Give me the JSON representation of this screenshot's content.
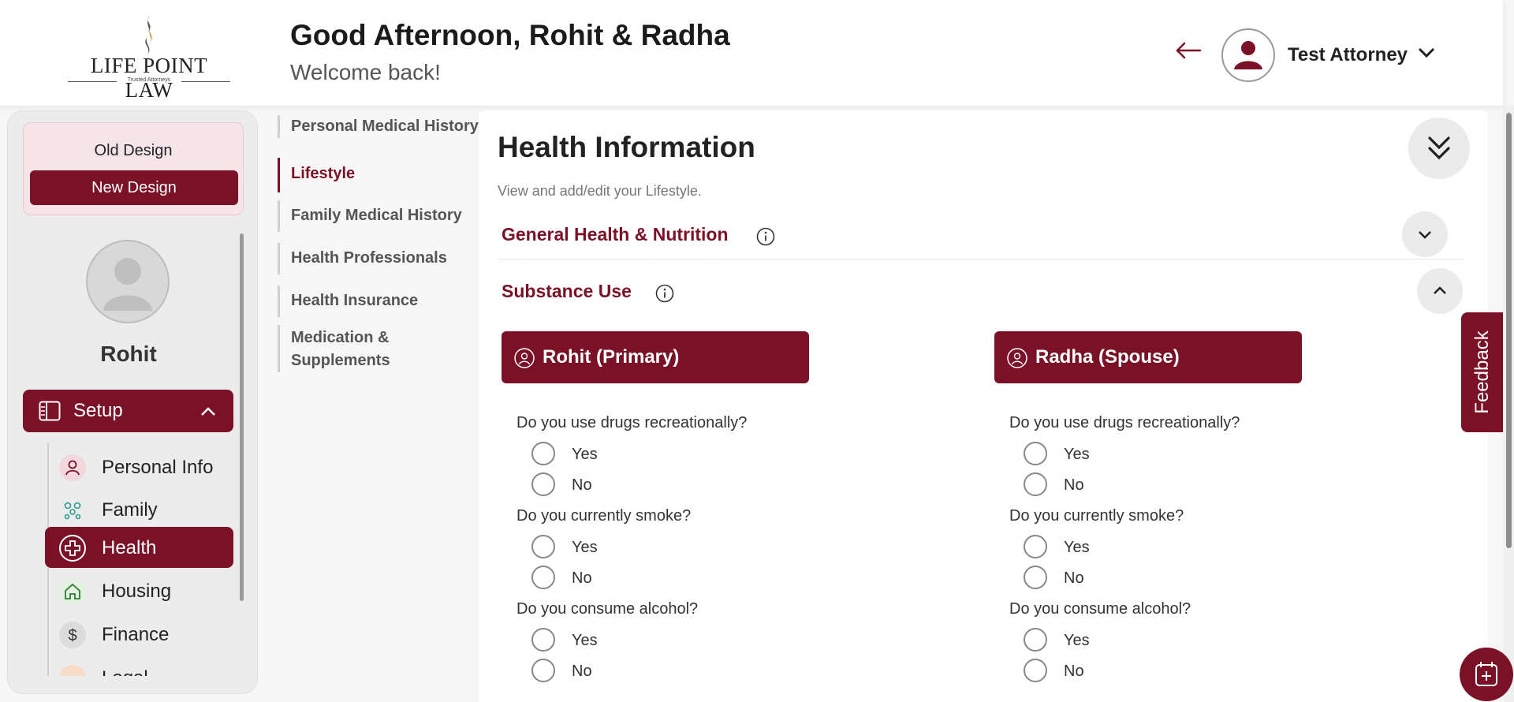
{
  "header": {
    "logo_text": "LIFE POINT LAW",
    "logo_tagline": "Trusted Attorneys",
    "greeting": "Good Afternoon, Rohit & Radha",
    "welcome": "Welcome back!",
    "user_name": "Test Attorney"
  },
  "sidebar": {
    "old_design": "Old Design",
    "new_design": "New Design",
    "profile_name": "Rohit",
    "setup_label": "Setup",
    "items": [
      {
        "label": "Personal Info",
        "icon": "person-icon"
      },
      {
        "label": "Family",
        "icon": "family-icon"
      },
      {
        "label": "Health",
        "icon": "health-cross-icon",
        "active": true
      },
      {
        "label": "Housing",
        "icon": "house-icon"
      },
      {
        "label": "Finance",
        "icon": "dollar-icon"
      },
      {
        "label": "Legal",
        "icon": "legal-icon"
      }
    ]
  },
  "subnav": {
    "items": [
      {
        "label": "Personal Medical History"
      },
      {
        "label": "Lifestyle",
        "active": true
      },
      {
        "label": "Family Medical History"
      },
      {
        "label": "Health Professionals"
      },
      {
        "label": "Health Insurance"
      },
      {
        "label": "Medication & Supplements"
      }
    ]
  },
  "main": {
    "title": "Health Information",
    "subtitle": "View and add/edit your Lifestyle.",
    "sections": [
      {
        "title": "General Health & Nutrition",
        "expanded": false
      },
      {
        "title": "Substance Use",
        "expanded": true
      }
    ],
    "people": [
      {
        "label": "Rohit (Primary)"
      },
      {
        "label": "Radha (Spouse)"
      }
    ],
    "questions": [
      {
        "text": "Do you use drugs recreationally?",
        "options": [
          "Yes",
          "No"
        ]
      },
      {
        "text": "Do you currently smoke?",
        "options": [
          "Yes",
          "No"
        ]
      },
      {
        "text": "Do you consume alcohol?",
        "options": [
          "Yes",
          "No"
        ]
      }
    ]
  },
  "feedback_label": "Feedback",
  "colors": {
    "brand": "#7b1126",
    "background": "#f6f6f6"
  }
}
